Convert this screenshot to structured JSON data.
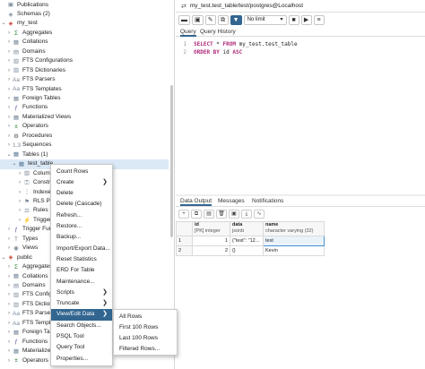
{
  "tree": {
    "rows": [
      {
        "label": "Publications",
        "icon": "publication-icon",
        "level": 0,
        "chev": ""
      },
      {
        "label": "Schemas (2)",
        "icon": "schemas-icon",
        "level": 0,
        "chev": ""
      },
      {
        "label": "my_test",
        "icon": "schema-icon",
        "level": 0,
        "chev": "⌄"
      },
      {
        "label": "Aggregates",
        "icon": "aggregate-icon",
        "level": 1,
        "chev": "›"
      },
      {
        "label": "Collations",
        "icon": "collation-icon",
        "level": 1,
        "chev": "›"
      },
      {
        "label": "Domains",
        "icon": "domain-icon",
        "level": 1,
        "chev": "›"
      },
      {
        "label": "FTS Configurations",
        "icon": "fts-config-icon",
        "level": 1,
        "chev": "›"
      },
      {
        "label": "FTS Dictionaries",
        "icon": "fts-dict-icon",
        "level": 1,
        "chev": "›"
      },
      {
        "label": "FTS Parsers",
        "icon": "fts-parser-icon",
        "level": 1,
        "chev": "›"
      },
      {
        "label": "FTS Templates",
        "icon": "fts-template-icon",
        "level": 1,
        "chev": "›"
      },
      {
        "label": "Foreign Tables",
        "icon": "foreign-table-icon",
        "level": 1,
        "chev": "›"
      },
      {
        "label": "Functions",
        "icon": "function-icon",
        "level": 1,
        "chev": "›"
      },
      {
        "label": "Materialized Views",
        "icon": "matview-icon",
        "level": 1,
        "chev": "›"
      },
      {
        "label": "Operators",
        "icon": "operator-icon",
        "level": 1,
        "chev": "›"
      },
      {
        "label": "Procedures",
        "icon": "procedure-icon",
        "level": 1,
        "chev": "›"
      },
      {
        "label": "Sequences",
        "icon": "sequence-icon",
        "level": 1,
        "chev": "›"
      },
      {
        "label": "Tables (1)",
        "icon": "tables-icon",
        "level": 1,
        "chev": "⌄"
      },
      {
        "label": "test_table",
        "icon": "table-icon",
        "level": 2,
        "chev": "⌄",
        "selected": true
      },
      {
        "label": "Columns",
        "icon": "columns-icon",
        "level": 3,
        "chev": "›"
      },
      {
        "label": "Constrain",
        "icon": "constraint-icon",
        "level": 3,
        "chev": "›"
      },
      {
        "label": "Indexes",
        "icon": "index-icon",
        "level": 3,
        "chev": "›"
      },
      {
        "label": "RLS Polic",
        "icon": "rls-icon",
        "level": 3,
        "chev": "›"
      },
      {
        "label": "Rules",
        "icon": "rule-icon",
        "level": 3,
        "chev": "›"
      },
      {
        "label": "Triggers",
        "icon": "trigger-icon",
        "level": 3,
        "chev": "›"
      },
      {
        "label": "Trigger Functi",
        "icon": "trigger-fn-icon",
        "level": 1,
        "chev": "›"
      },
      {
        "label": "Types",
        "icon": "type-icon",
        "level": 1,
        "chev": "›"
      },
      {
        "label": "Views",
        "icon": "view-icon",
        "level": 1,
        "chev": "›"
      },
      {
        "label": "public",
        "icon": "schema-icon",
        "level": 0,
        "chev": "⌄"
      },
      {
        "label": "Aggregates",
        "icon": "aggregate-icon",
        "level": 1,
        "chev": "›"
      },
      {
        "label": "Collations",
        "icon": "collation-icon",
        "level": 1,
        "chev": "›"
      },
      {
        "label": "Domains",
        "icon": "domain-icon",
        "level": 1,
        "chev": "›"
      },
      {
        "label": "FTS Configurati",
        "icon": "fts-config-icon",
        "level": 1,
        "chev": "›"
      },
      {
        "label": "FTS Dictionarie",
        "icon": "fts-dict-icon",
        "level": 1,
        "chev": "›"
      },
      {
        "label": "FTS Parsers",
        "icon": "fts-parser-icon",
        "level": 1,
        "chev": "›"
      },
      {
        "label": "FTS Templates",
        "icon": "fts-template-icon",
        "level": 1,
        "chev": "›"
      },
      {
        "label": "Foreign Tables",
        "icon": "foreign-table-icon",
        "level": 1,
        "chev": "›"
      },
      {
        "label": "Functions",
        "icon": "function-icon",
        "level": 1,
        "chev": "›"
      },
      {
        "label": "Materialized Vi",
        "icon": "matview-icon",
        "level": 1,
        "chev": "›"
      },
      {
        "label": "Operators",
        "icon": "operator-icon",
        "level": 1,
        "chev": "›"
      }
    ]
  },
  "context_menu": {
    "items": [
      {
        "label": "Count Rows",
        "sub": false
      },
      {
        "label": "Create",
        "sub": true
      },
      {
        "label": "Delete",
        "sub": false
      },
      {
        "label": "Delete (Cascade)",
        "sub": false
      },
      {
        "label": "Refresh...",
        "sub": false
      },
      {
        "label": "Restore...",
        "sub": false
      },
      {
        "label": "Backup...",
        "sub": false
      },
      {
        "label": "Import/Export Data...",
        "sub": false
      },
      {
        "label": "Reset Statistics",
        "sub": false
      },
      {
        "label": "ERD For Table",
        "sub": false
      },
      {
        "label": "Maintenance...",
        "sub": false
      },
      {
        "label": "Scripts",
        "sub": true
      },
      {
        "label": "Truncate",
        "sub": true
      },
      {
        "label": "View/Edit Data",
        "sub": true,
        "active": true
      },
      {
        "label": "Search Objects...",
        "sub": false
      },
      {
        "label": "PSQL Tool",
        "sub": false
      },
      {
        "label": "Query Tool",
        "sub": false
      },
      {
        "label": "Properties...",
        "sub": false
      }
    ],
    "submenu": [
      "All Rows",
      "First 100 Rows",
      "Last 100 Rows",
      "Filtered Rows..."
    ]
  },
  "header": {
    "connection_title": "my_test.test_table/test/postgres@Localhost",
    "limit_label": "No limit"
  },
  "query_tabs": [
    "Query",
    "Query History"
  ],
  "editor": {
    "lines": [
      {
        "num": "1",
        "kw1": "SELECT",
        "rest1": " * ",
        "kw2": "FROM",
        "rest2": " my_test.test_table"
      },
      {
        "num": "2",
        "kw1": "ORDER BY",
        "rest1": " id ",
        "kw2": "ASC",
        "rest2": ""
      }
    ]
  },
  "data_tabs": [
    "Data Output",
    "Messages",
    "Notifications"
  ],
  "grid": {
    "columns": [
      {
        "name": "id",
        "type": "[PK] integer"
      },
      {
        "name": "data",
        "type": "jsonb"
      },
      {
        "name": "name",
        "type": "character varying (32)"
      }
    ],
    "rows": [
      {
        "rownum": "1",
        "id": "1",
        "data": "{\"test\": \"12...",
        "name": "test"
      },
      {
        "rownum": "2",
        "id": "2",
        "data": "{}",
        "name": "Kevin"
      }
    ]
  },
  "colors": {
    "accent": "#326690",
    "selection": "#dbe8f6"
  }
}
